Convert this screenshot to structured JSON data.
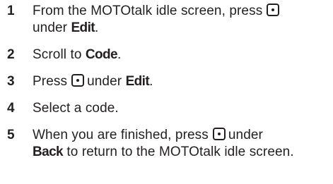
{
  "steps": [
    {
      "number": "1",
      "parts": {
        "a": "From the MOTOtalk idle screen, press",
        "b": "under ",
        "c": "Edit",
        "d": "."
      }
    },
    {
      "number": "2",
      "parts": {
        "a": "Scroll to ",
        "b": "Code",
        "c": "."
      }
    },
    {
      "number": "3",
      "parts": {
        "a": "Press",
        "b": "under ",
        "c": "Edit",
        "d": "."
      }
    },
    {
      "number": "4",
      "parts": {
        "a": "Select a code."
      }
    },
    {
      "number": "5",
      "parts": {
        "a": "When you are finished, press",
        "b": "under",
        "c": "Back",
        "d": " to return to the MOTOtalk idle screen."
      }
    }
  ],
  "icons": {
    "select_key": "center-select-key-icon"
  }
}
